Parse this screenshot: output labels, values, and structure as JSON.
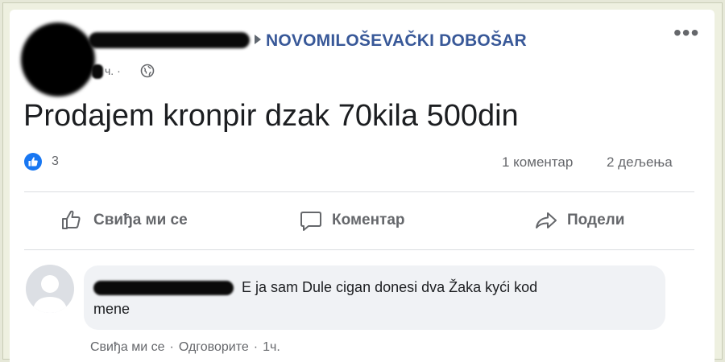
{
  "post": {
    "group_name": "NOVOMILOŠEVAČKI DOBOŠAR",
    "time_suffix": "ч. ·",
    "text": "Prodajem kronpir dzak 70kila 500din",
    "more_label": "•••"
  },
  "stats": {
    "reaction_count": "3",
    "comments": "1 коментар",
    "shares": "2 дељења"
  },
  "actions": {
    "like": "Свиђа ми се",
    "comment": "Коментар",
    "share": "Подели"
  },
  "comment": {
    "text_line1": "E ja sam Dule cigan donesi dva Žaka kyći kod",
    "text_line2": "mene",
    "like": "Свиђа ми се",
    "sep1": "·",
    "reply": "Одговорите",
    "sep2": "·",
    "time": "1ч."
  },
  "colors": {
    "group_link": "#385898",
    "like_blue": "#1877f2",
    "muted": "#65676b"
  },
  "icons": [
    "globe-icon",
    "like-badge-icon",
    "thumbs-up-icon",
    "comment-icon",
    "share-icon",
    "more-icon",
    "default-avatar-icon"
  ]
}
